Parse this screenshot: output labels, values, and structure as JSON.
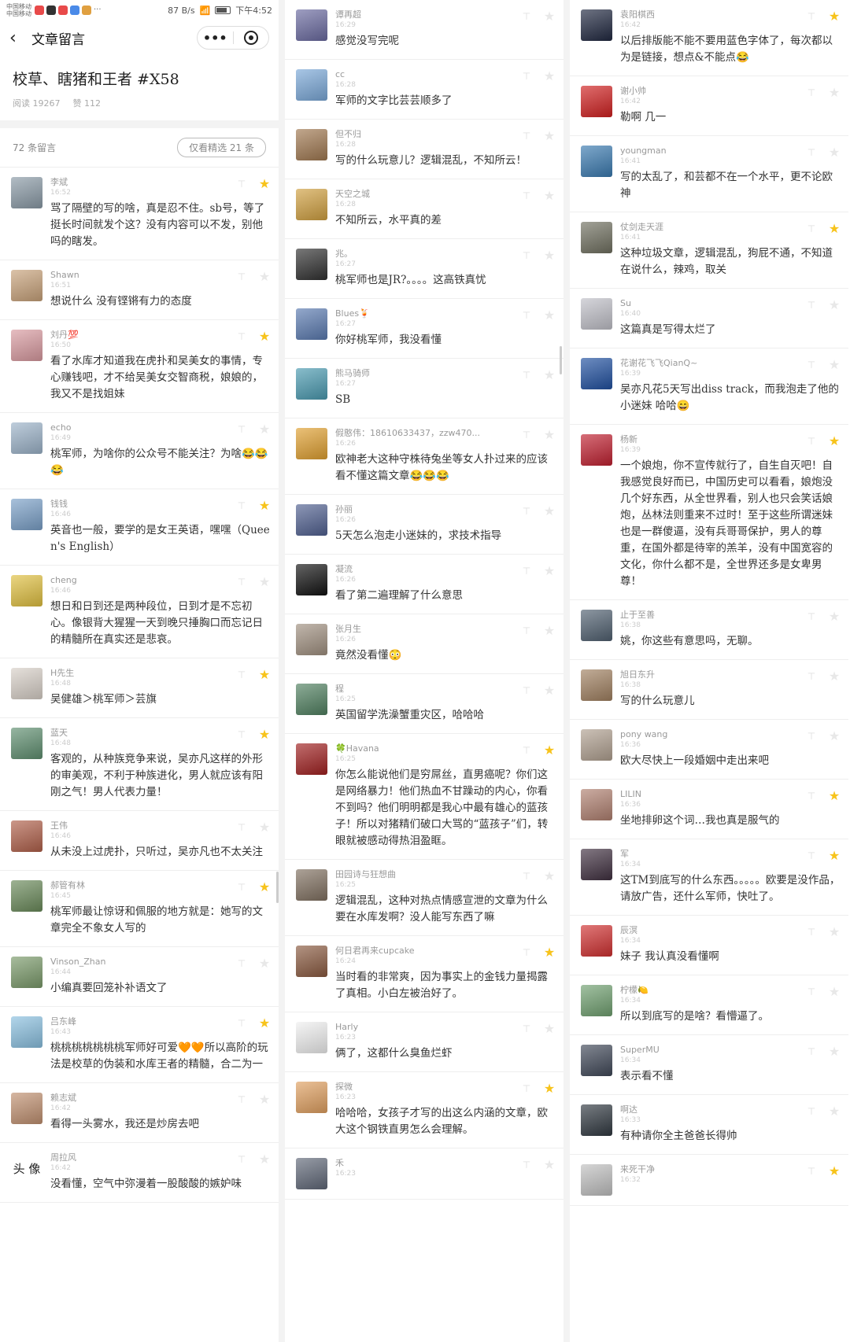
{
  "status": {
    "carrier": [
      "中国移动",
      "中国移动"
    ],
    "speed": "87 B/s",
    "time": "下午4:52"
  },
  "nav": {
    "title": "文章留言",
    "more": "•••"
  },
  "article": {
    "title": "校草、瞎猪和王者 #X58",
    "reads": "阅读 19267",
    "likes": "赞 112"
  },
  "comment_header": {
    "count": "72 条留言",
    "filter": "仅看精选 21 条"
  },
  "colors": {
    "star_on": "#f7c31b",
    "star_off": "#e8e8e8",
    "background": "#ffffff",
    "divider": "#eeeeee"
  },
  "columns": [
    [
      {
        "name": "李斌",
        "time": "16:52",
        "text": "骂了隔壁的写的啥，真是忍不住。sb号，等了挺长时间就发个这？没有内容可以不发，别他吗的瞎发。",
        "star": true,
        "avatar": "#8a9aa6"
      },
      {
        "name": "Shawn",
        "time": "16:51",
        "text": "想说什么 没有铿锵有力的态度",
        "star": false,
        "avatar": "#c8a27a"
      },
      {
        "name": "刘丹💯",
        "time": "16:50",
        "text": "看了水库才知道我在虎扑和吴美女的事情，专心赚钱吧，才不给吴美女交智商税，娘娘的，我又不是找姐妹",
        "star": true,
        "avatar": "#d99aa0"
      },
      {
        "name": "echo",
        "time": "16:49",
        "text": "桃军师，为啥你的公众号不能关注？为啥😂😂😂",
        "star": false,
        "avatar": "#9cb3c9"
      },
      {
        "name": "钱钱",
        "time": "16:46",
        "text": "英音也一般，要学的是女王英语，嘿嘿（Queen's English）",
        "star": true,
        "avatar": "#7aa0c8"
      },
      {
        "name": "cheng",
        "time": "16:46",
        "text": "想日和日到还是两种段位，日到才是不忘初心。像银背大猩猩一天到晚只捶胸口而忘记日的精髓所在真实还是悲哀。",
        "star": false,
        "avatar": "#e0c040"
      },
      {
        "name": "H先生",
        "time": "16:48",
        "text": "吴健雄＞桃军师＞芸旗",
        "star": true,
        "avatar": "#d8d0c8"
      },
      {
        "name": "蓝天",
        "time": "16:48",
        "text": "客观的，从种族竞争来说，吴亦凡这样的外形的审美观，不利于种族进化，男人就应该有阳刚之气！男人代表力量！",
        "star": true,
        "avatar": "#5f8f70"
      },
      {
        "name": "王伟",
        "time": "16:46",
        "text": "从未没上过虎扑，只听过，吴亦凡也不太关注",
        "star": false,
        "avatar": "#b0604a"
      },
      {
        "name": "郝管有林",
        "time": "16:45",
        "text": "桃军师最让惊讶和佩服的地方就是：她写的文章完全不象女人写的",
        "star": true,
        "avatar": "#6a8a5a"
      },
      {
        "name": "Vinson_Zhan",
        "time": "16:44",
        "text": "小编真要回笼补补语文了",
        "star": false,
        "avatar": "#7a9a6a"
      },
      {
        "name": "吕东峰",
        "time": "16:43",
        "text": "桃桃桃桃桃桃桃军师好可爱🧡🧡所以高阶的玩法是校草的伪装和水库王者的精髓，合二为一",
        "star": true,
        "avatar": "#8ac0e0"
      },
      {
        "name": "赖志斌",
        "time": "16:42",
        "text": "看得一头雾水，我还是炒房去吧",
        "star": false,
        "avatar": "#c09070"
      },
      {
        "name": "周拉风",
        "time": "16:42",
        "text": "没看懂，空气中弥漫着一股酸酸的嫉妒味",
        "star": false,
        "avatar": "#ffffff",
        "avatar_label": "头 像"
      }
    ],
    [
      {
        "name": "谭再超",
        "time": "16:29",
        "text": "感觉没写完呢",
        "star": false,
        "avatar": "#6a6aa0"
      },
      {
        "name": "cc",
        "time": "16:28",
        "text": "军师的文字比芸芸顺多了",
        "star": false,
        "avatar": "#7aa8d8"
      },
      {
        "name": "但不归",
        "time": "16:28",
        "text": "写的什么玩意儿？逻辑混乱，不知所云！",
        "star": false,
        "avatar": "#a07850"
      },
      {
        "name": "天空之城",
        "time": "16:28",
        "text": "不知所云，水平真的差",
        "star": false,
        "avatar": "#d0a040"
      },
      {
        "name": "兆。",
        "time": "16:27",
        "text": "桃军师也是JR?。。。。这高铁真忧",
        "star": false,
        "avatar": "#303030"
      },
      {
        "name": "Blues🍹",
        "time": "16:27",
        "text": "你好桃军师，我没看懂",
        "star": false,
        "avatar": "#5a7ab0"
      },
      {
        "name": "熊马骑师",
        "time": "16:27",
        "text": "SB",
        "star": false,
        "avatar": "#4a9ab0"
      },
      {
        "name": "假憨伟：18610633437，zzw470...",
        "time": "16:26",
        "text": "欧神老大这种守株待兔坐等女人扑过来的应该看不懂这篇文章😂😂😂",
        "star": false,
        "avatar": "#e0a030"
      },
      {
        "name": "孙丽",
        "time": "16:26",
        "text": "5天怎么泡走小迷妹的，求技术指导",
        "star": false,
        "avatar": "#506090"
      },
      {
        "name": "凝流",
        "time": "16:26",
        "text": "看了第二遍理解了什么意思",
        "star": false,
        "avatar": "#111111"
      },
      {
        "name": "张月生",
        "time": "16:26",
        "text": "竟然没看懂😳",
        "star": false,
        "avatar": "#a09080"
      },
      {
        "name": "程",
        "time": "16:25",
        "text": "英国留学洗澡蟹重灾区，哈哈哈",
        "star": false,
        "avatar": "#508060"
      },
      {
        "name": "🍀Havana",
        "time": "16:25",
        "text": "你怎么能说他们是穷屌丝，直男癌呢？你们这是网络暴力！他们热血不甘躁动的内心，你看不到吗？他们明明都是我心中最有雄心的蓝孩子！所以对猪精们破口大骂的“蓝孩子”们，转眼就被感动得热泪盈眶。",
        "star": true,
        "avatar": "#a02020"
      },
      {
        "name": "田园诗与狂想曲",
        "time": "16:25",
        "text": "逻辑混乱，这种对热点情感宣泄的文章为什么要在水库发啊？没人能写东西了嘛",
        "star": false,
        "avatar": "#807060"
      },
      {
        "name": "何日君再来cupcake",
        "time": "16:24",
        "text": "当时看的非常爽，因为事实上的金钱力量揭露了真相。小白左被治好了。",
        "star": true,
        "avatar": "#8a5a40"
      },
      {
        "name": "Harly",
        "time": "16:23",
        "text": "俩了，这都什么臭鱼烂虾",
        "star": false,
        "avatar": "#f0f0f0"
      },
      {
        "name": "探微",
        "time": "16:23",
        "text": "哈哈哈，女孩子才写的出这么内涵的文章，欧大这个钢铁直男怎么会理解。",
        "star": true,
        "avatar": "#e0a060"
      },
      {
        "name": "禾",
        "time": "16:23",
        "text": "",
        "star": false,
        "avatar": "#606878"
      }
    ],
    [
      {
        "name": "袁阳棋西",
        "time": "16:42",
        "text": "以后排版能不能不要用蓝色字体了，每次都以为是链接，想点&不能点😂",
        "star": true,
        "avatar": "#202840"
      },
      {
        "name": "谢小帅",
        "time": "16:42",
        "text": "勒啊 几一",
        "star": false,
        "avatar": "#d02020"
      },
      {
        "name": "youngman",
        "time": "16:41",
        "text": "写的太乱了，和芸都不在一个水平，更不论欧神",
        "star": false,
        "avatar": "#3a7ab0"
      },
      {
        "name": "仗剑走天涯",
        "time": "16:41",
        "text": "这种垃圾文章，逻辑混乱，狗屁不通，不知道在说什么，辣鸡，取关",
        "star": true,
        "avatar": "#707060"
      },
      {
        "name": "Su",
        "time": "16:40",
        "text": "这篇真是写得太烂了",
        "star": false,
        "avatar": "#c0c0c8"
      },
      {
        "name": "花谢花飞飞QianQ~",
        "time": "16:39",
        "text": "吴亦凡花5天写出diss track，而我泡走了他的小迷妹 哈哈😄",
        "star": false,
        "avatar": "#2050a0"
      },
      {
        "name": "杨新",
        "time": "16:39",
        "text": "一个娘炮，你不宣传就行了，自生自灭吧！自我感觉良好而已，中国历史可以看看，娘炮没几个好东西，从全世界看，别人也只会笑话娘炮，丛林法则重来不过时！至于这些所谓迷妹也是一群傻逼，没有兵哥哥保护，男人的尊重，在国外都是待宰的羔羊，没有中国宽容的文化，你什么都不是，全世界还多是女卑男尊！",
        "star": true,
        "avatar": "#c02030"
      },
      {
        "name": "止于至善",
        "time": "16:38",
        "text": "姚，你这些有意思吗，无聊。",
        "star": false,
        "avatar": "#506070"
      },
      {
        "name": "旭日东升",
        "time": "16:38",
        "text": "写的什么玩意儿",
        "star": false,
        "avatar": "#a08060"
      },
      {
        "name": "pony wang",
        "time": "16:36",
        "text": "欧大尽快上一段婚姻中走出来吧",
        "star": false,
        "avatar": "#b0a090"
      },
      {
        "name": "LILIN",
        "time": "16:36",
        "text": "坐地排卵这个词…我也真是服气的",
        "star": true,
        "avatar": "#b08070"
      },
      {
        "name": "军",
        "time": "16:34",
        "text": "这TM到底写的什么东西。。。。。欧要是没作品，请放广告，还什么军师，快吐了。",
        "star": true,
        "avatar": "#403040"
      },
      {
        "name": "辰溟",
        "time": "16:34",
        "text": "妹子 我认真没看懂啊",
        "star": false,
        "avatar": "#d03030"
      },
      {
        "name": "柠檬🍋",
        "time": "16:34",
        "text": "所以到底写的是啥？看懵逼了。",
        "star": false,
        "avatar": "#70a070"
      },
      {
        "name": "SuperMU",
        "time": "16:34",
        "text": "表示看不懂",
        "star": false,
        "avatar": "#404858"
      },
      {
        "name": "啊达",
        "time": "16:33",
        "text": "有种请你全主爸爸长得帅",
        "star": false,
        "avatar": "#303840"
      },
      {
        "name": "来死干净",
        "time": "16:32",
        "text": "",
        "star": true,
        "avatar": "#c0c0c0"
      }
    ]
  ]
}
